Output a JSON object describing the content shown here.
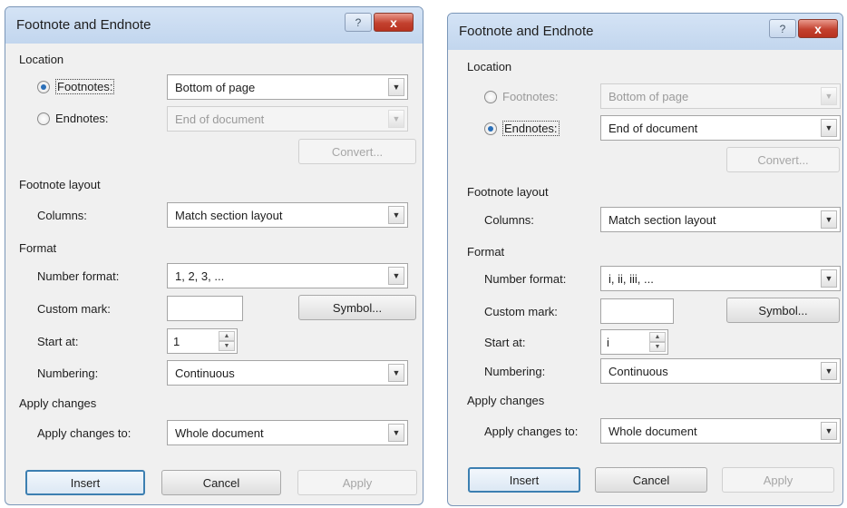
{
  "dialogs": [
    {
      "title": "Footnote and Endnote",
      "help_glyph": "?",
      "close_glyph": "x",
      "location_header": "Location",
      "footnotes_label": "Footnotes:",
      "footnotes_value": "Bottom of page",
      "endnotes_label": "Endnotes:",
      "endnotes_value": "End of document",
      "selected_option": "footnotes",
      "convert_label": "Convert...",
      "layout_header": "Footnote layout",
      "columns_label": "Columns:",
      "columns_value": "Match section layout",
      "format_header": "Format",
      "number_format_label": "Number format:",
      "number_format_value": "1, 2, 3, ...",
      "custom_mark_label": "Custom mark:",
      "custom_mark_value": "",
      "symbol_label": "Symbol...",
      "start_at_label": "Start at:",
      "start_at_value": "1",
      "numbering_label": "Numbering:",
      "numbering_value": "Continuous",
      "apply_header": "Apply changes",
      "apply_to_label": "Apply changes to:",
      "apply_to_value": "Whole document",
      "insert_label": "Insert",
      "cancel_label": "Cancel",
      "apply_label": "Apply"
    },
    {
      "title": "Footnote and Endnote",
      "help_glyph": "?",
      "close_glyph": "x",
      "location_header": "Location",
      "footnotes_label": "Footnotes:",
      "footnotes_value": "Bottom of page",
      "endnotes_label": "Endnotes:",
      "endnotes_value": "End of document",
      "selected_option": "endnotes",
      "convert_label": "Convert...",
      "layout_header": "Footnote layout",
      "columns_label": "Columns:",
      "columns_value": "Match section layout",
      "format_header": "Format",
      "number_format_label": "Number format:",
      "number_format_value": "i, ii, iii, ...",
      "custom_mark_label": "Custom mark:",
      "custom_mark_value": "",
      "symbol_label": "Symbol...",
      "start_at_label": "Start at:",
      "start_at_value": "i",
      "numbering_label": "Numbering:",
      "numbering_value": "Continuous",
      "apply_header": "Apply changes",
      "apply_to_label": "Apply changes to:",
      "apply_to_value": "Whole document",
      "insert_label": "Insert",
      "cancel_label": "Cancel",
      "apply_label": "Apply"
    }
  ],
  "colors": {
    "title_bar": "#c8daf0",
    "close_button": "#c3412f",
    "dialog_background": "#f0f0f0",
    "radio_selected": "#2a6fb8",
    "default_button_border": "#3c7fb1",
    "disabled_text": "#9a9a9a"
  },
  "icons": {
    "help": "question-mark-icon",
    "close": "close-x-icon",
    "dropdown": "chevron-down-icon",
    "spinner_up": "spin-up-icon",
    "spinner_down": "spin-down-icon"
  }
}
